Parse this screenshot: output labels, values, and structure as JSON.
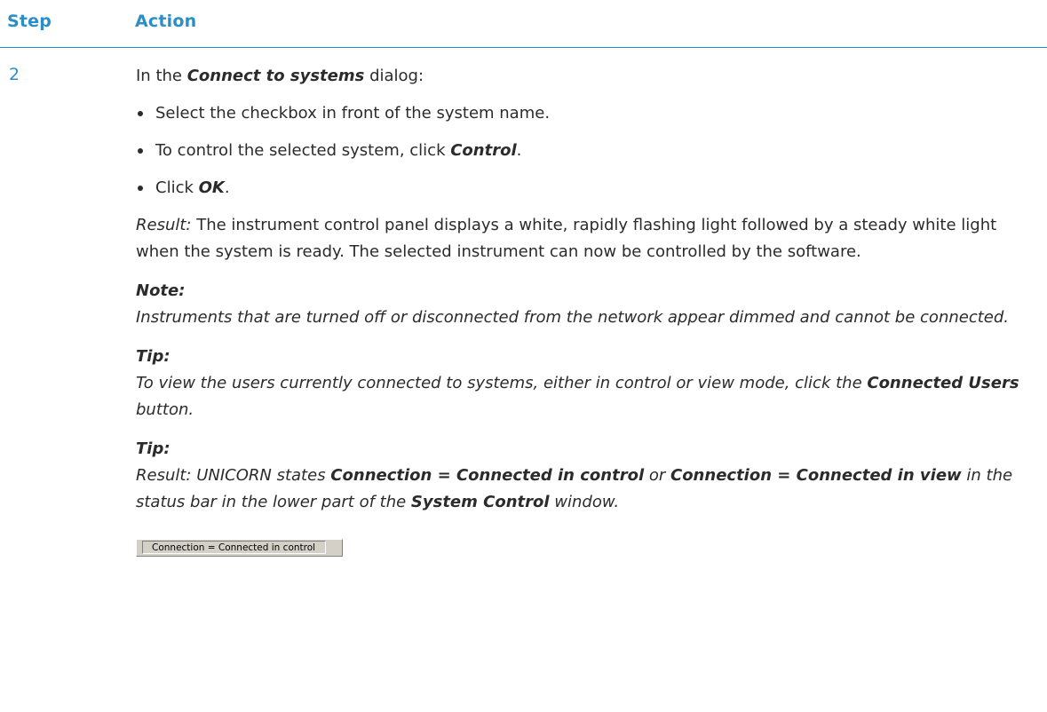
{
  "header": {
    "step": "Step",
    "action": "Action"
  },
  "step_number": "2",
  "intro": {
    "pre": "In the ",
    "bold": "Connect to systems",
    "post": " dialog:"
  },
  "bullets": [
    {
      "pre": "Select the checkbox in front of the system name.",
      "bold": "",
      "post": ""
    },
    {
      "pre": "To control the selected system, click ",
      "bold": "Control",
      "post": "."
    },
    {
      "pre": "Click ",
      "bold": "OK",
      "post": "."
    }
  ],
  "result": {
    "label": "Result:",
    "text": " The instrument control panel displays a white, rapidly flashing light followed by a steady white light when the system is ready. The selected instrument can now be controlled by the software."
  },
  "note": {
    "label": "Note:",
    "text": "Instruments that are turned off or disconnected from the network appear dimmed and cannot be connected."
  },
  "tip1": {
    "label": "Tip:",
    "pre": "To view the users currently connected to systems, either in control or view mode, click the ",
    "bold": "Connected Users",
    "post": " button."
  },
  "tip2": {
    "label": "Tip:",
    "pre": "Result: UNICORN states ",
    "bold1": "Connection = Connected in control",
    "mid1": " or ",
    "bold2": "Connection = Connected in view",
    "mid2": " in the status bar in the lower part of the ",
    "bold3": "System Control",
    "post": " window."
  },
  "statusbar": {
    "text": "Connection = Connected in control"
  }
}
